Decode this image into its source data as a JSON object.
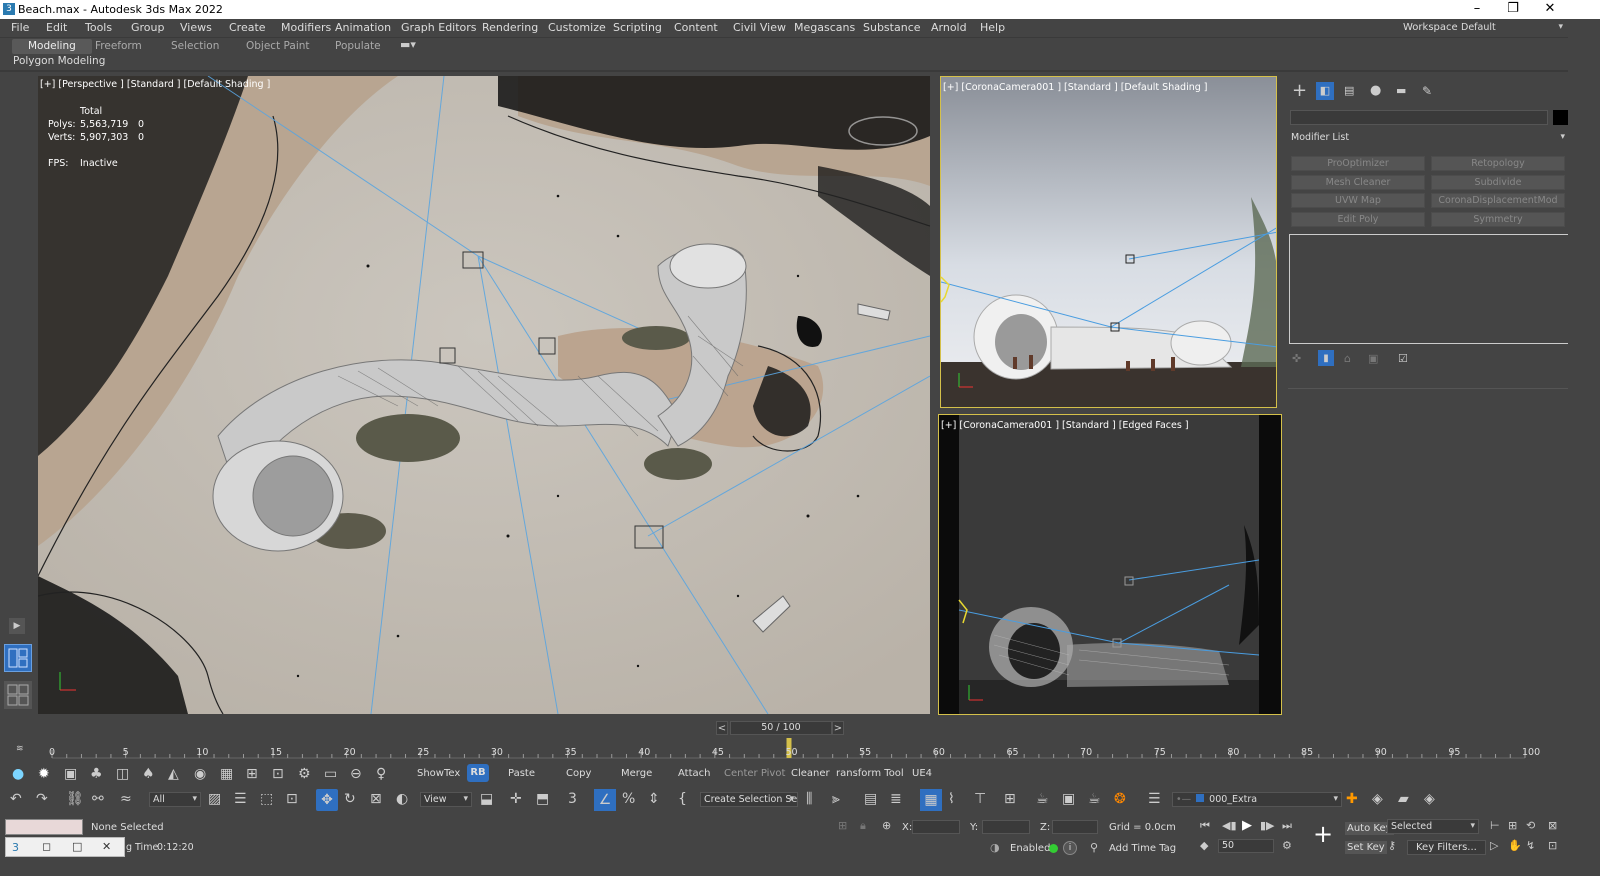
{
  "window": {
    "title": "Beach.max - Autodesk 3ds Max 2022",
    "minimize": "–",
    "restore": "❐",
    "close": "✕"
  },
  "menu": {
    "items": [
      "File",
      "Edit",
      "Tools",
      "Group",
      "Views",
      "Create",
      "Modifiers",
      "Animation",
      "Graph Editors",
      "Rendering",
      "Customize",
      "Scripting",
      "Content",
      "Civil View",
      "Megascans",
      "Substance",
      "Arnold",
      "Help"
    ],
    "workspaces_label": "Workspaces:",
    "workspace_value": "Default"
  },
  "ribbon": {
    "tabs": [
      "Modeling",
      "Freeform",
      "Selection",
      "Object Paint",
      "Populate"
    ],
    "active_tab": "Modeling",
    "sub_label": "Polygon Modeling"
  },
  "viewports": {
    "perspective": {
      "label": "[+] [Perspective ] [Standard ] [Default Shading ]",
      "stats_total": "Total",
      "polys_label": "Polys:",
      "polys_value": "5,563,719",
      "polys_sel": "0",
      "verts_label": "Verts:",
      "verts_value": "5,907,303",
      "verts_sel": "0",
      "fps_label": "FPS:",
      "fps_value": "Inactive"
    },
    "camera1": {
      "label": "[+] [CoronaCamera001 ] [Standard ] [Default Shading ]"
    },
    "camera2": {
      "label": "[+]   [CoronaCamera001 ] [Standard ] [Edged Faces ]"
    }
  },
  "command_panel": {
    "modifier_list": "Modifier List",
    "modifier_buttons": [
      "ProOptimizer",
      "Retopology",
      "Mesh Cleaner",
      "Subdivide",
      "UVW Map",
      "CoronaDisplacementMod",
      "Edit Poly",
      "Symmetry"
    ]
  },
  "timeline": {
    "frame_display": "50 / 100",
    "current_frame": 50,
    "total_frames": 100,
    "prev": "<",
    "next": ">",
    "ticks": [
      "0",
      "5",
      "10",
      "15",
      "20",
      "25",
      "30",
      "35",
      "40",
      "45",
      "50",
      "55",
      "60",
      "65",
      "70",
      "75",
      "80",
      "85",
      "90",
      "95",
      "100"
    ]
  },
  "toolbar1": {
    "buttons": [
      "ShowTex",
      "RB",
      "Paste",
      "Copy",
      "Merge",
      "Attach",
      "Center Pivot",
      "Cleaner",
      "ransform Tool",
      "UE4"
    ]
  },
  "toolbar2": {
    "filter_value": "All",
    "view_value": "View",
    "selection_set": "Create Selection Se",
    "layer_value": "000_Extra"
  },
  "status": {
    "selection": "None Selected",
    "render_time_label": "g Time",
    "render_time_value": "0:12:20",
    "x_label": "X:",
    "y_label": "Y:",
    "z_label": "Z:",
    "grid": "Grid = 0.0cm",
    "enabled_label": "Enabled:",
    "add_time_tag": "Add Time Tag",
    "auto_key": "Auto Key",
    "set_key": "Set Key",
    "key_mode": "Selected",
    "frame_spinner": "50",
    "key_filters": "Key Filters..."
  },
  "colors": {
    "ui_bg": "#444444",
    "accent_blue": "#2f6fc0",
    "active_viewport_border": "#d4c04a",
    "sand": "#c2bcb2",
    "wet_sand": "#b8a591"
  }
}
